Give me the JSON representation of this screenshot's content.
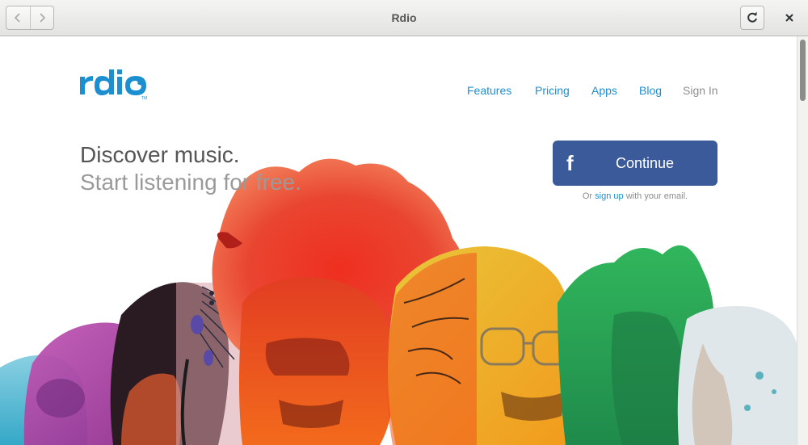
{
  "window": {
    "title": "Rdio",
    "back_icon": "chevron-left-icon",
    "forward_icon": "chevron-right-icon",
    "reload_icon": "reload-icon",
    "close_icon": "close-icon"
  },
  "brand": {
    "name": "rdio",
    "color": "#1c8fd0"
  },
  "nav": {
    "items": [
      {
        "label": "Features"
      },
      {
        "label": "Pricing"
      },
      {
        "label": "Apps"
      },
      {
        "label": "Blog"
      },
      {
        "label": "Sign In"
      }
    ]
  },
  "hero": {
    "headline_line1": "Discover music.",
    "headline_line2": "Start listening for free."
  },
  "cta": {
    "facebook_icon": "facebook-icon",
    "button_label": "Continue",
    "button_color": "#3b5a9a",
    "note_prefix": "Or ",
    "note_link": "sign up",
    "note_suffix": " with your email."
  }
}
